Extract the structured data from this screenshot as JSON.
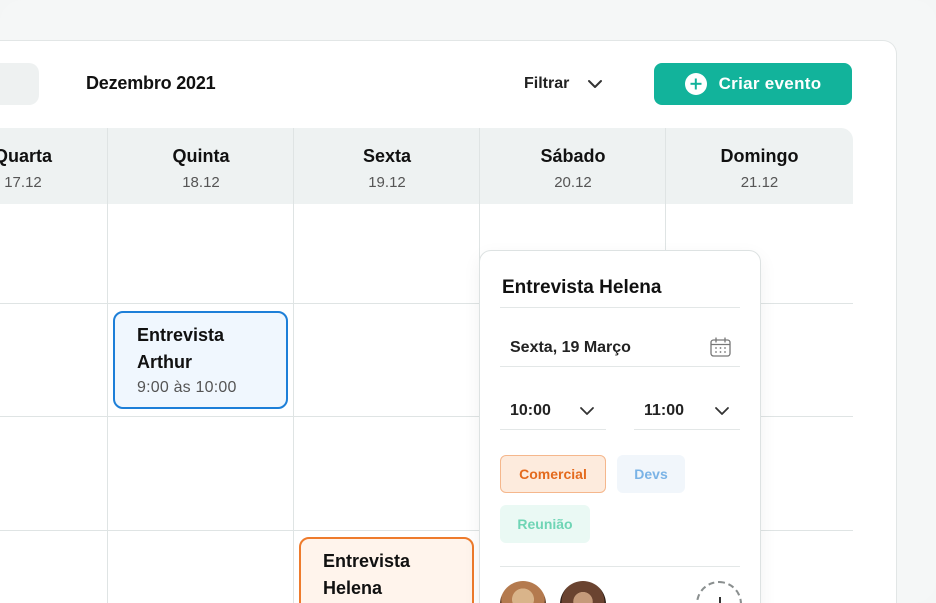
{
  "header": {
    "month": "Dezembro 2021",
    "filter_label": "Filtrar",
    "create_label": "Criar evento"
  },
  "days": [
    {
      "name": "Quarta",
      "date": "17.12"
    },
    {
      "name": "Quinta",
      "date": "18.12"
    },
    {
      "name": "Sexta",
      "date": "19.12"
    },
    {
      "name": "Sábado",
      "date": "20.12"
    },
    {
      "name": "Domingo",
      "date": "21.12"
    }
  ],
  "events": [
    {
      "title": "Entrevista Arthur",
      "time": "9:00 às 10:00",
      "color": "#1d7fd8"
    },
    {
      "title": "Entrevista Helena",
      "color": "#ee7b2c"
    }
  ],
  "popup": {
    "title": "Entrevista Helena",
    "date": "Sexta, 19 Março",
    "start": "10:00",
    "end": "11:00",
    "tags": [
      {
        "label": "Comercial",
        "selected": true
      },
      {
        "label": "Devs",
        "selected": false
      },
      {
        "label": "Reunião",
        "selected": false
      }
    ]
  },
  "colors": {
    "accent": "#12b39b",
    "header_bg": "#eef2f2",
    "tag_comercial": "#e46a1d",
    "tag_devs": "#7ab3e6",
    "tag_reuniao": "#6fd5b5"
  },
  "icons": [
    "plus-icon",
    "chevron-down-icon",
    "calendar-icon",
    "add-person-icon"
  ]
}
